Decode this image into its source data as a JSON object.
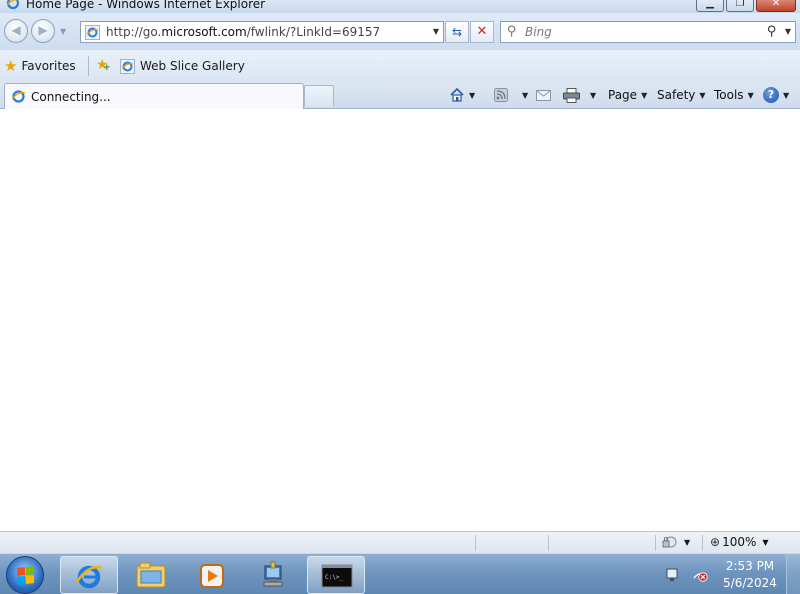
{
  "window": {
    "title": "Home Page - Windows Internet Explorer",
    "minimize_icon": "minimize-icon",
    "maximize_icon": "maximize-icon",
    "close_icon": "close-icon"
  },
  "navigation": {
    "address_url_prefix": "http://go.",
    "address_url_domain": "microsoft.com",
    "address_url_suffix": "/fwlink/?LinkId=69157",
    "search_placeholder": "Bing"
  },
  "favorites_bar": {
    "favorites_label": "Favorites",
    "web_slice_label": "Web Slice Gallery"
  },
  "tab": {
    "label": "Connecting..."
  },
  "command_bar": {
    "page_label": "Page",
    "safety_label": "Safety",
    "tools_label": "Tools"
  },
  "status_bar": {
    "text": "",
    "zoom": "100%"
  },
  "taskbar": {
    "time": "2:53 PM",
    "date": "5/6/2024",
    "items": [
      "internet-explorer",
      "windows-explorer",
      "media-player",
      "network-app",
      "command-prompt"
    ]
  },
  "colors": {
    "accent": "#2c6cc0",
    "stop_red": "#d02a1e",
    "favorites_star": "#e9a400"
  }
}
